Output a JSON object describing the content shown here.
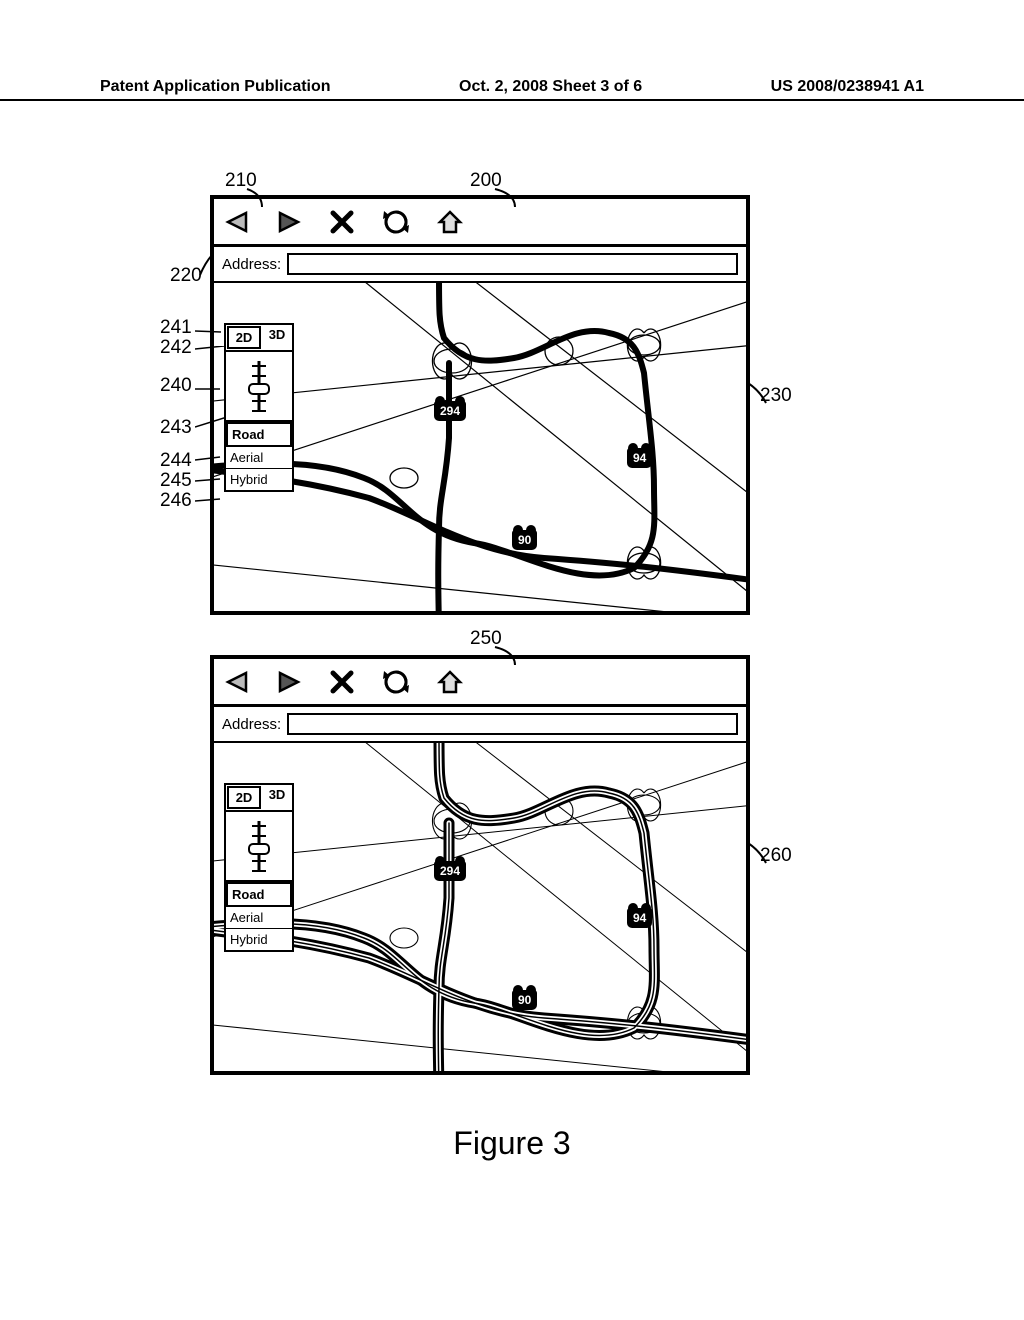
{
  "header": {
    "left": "Patent Application Publication",
    "center": "Oct. 2, 2008  Sheet 3 of 6",
    "right": "US 2008/0238941 A1"
  },
  "figure_caption": "Figure 3",
  "window_top": {
    "address_label": "Address:",
    "controls": {
      "dim_2d": "2D",
      "dim_3d": "3D",
      "modes": {
        "road": "Road",
        "aerial": "Aerial",
        "hybrid": "Hybrid"
      }
    },
    "shields": {
      "s294": "294",
      "s94": "94",
      "s90": "90"
    }
  },
  "window_bottom": {
    "address_label": "Address:",
    "controls": {
      "dim_2d": "2D",
      "dim_3d": "3D",
      "modes": {
        "road": "Road",
        "aerial": "Aerial",
        "hybrid": "Hybrid"
      }
    },
    "shields": {
      "s294": "294",
      "s94": "94",
      "s90": "90"
    }
  },
  "callouts": {
    "c200": "200",
    "c210": "210",
    "c220": "220",
    "c230": "230",
    "c240": "240",
    "c241": "241",
    "c242": "242",
    "c243": "243",
    "c244": "244",
    "c245": "245",
    "c246": "246",
    "c250": "250",
    "c260": "260"
  }
}
